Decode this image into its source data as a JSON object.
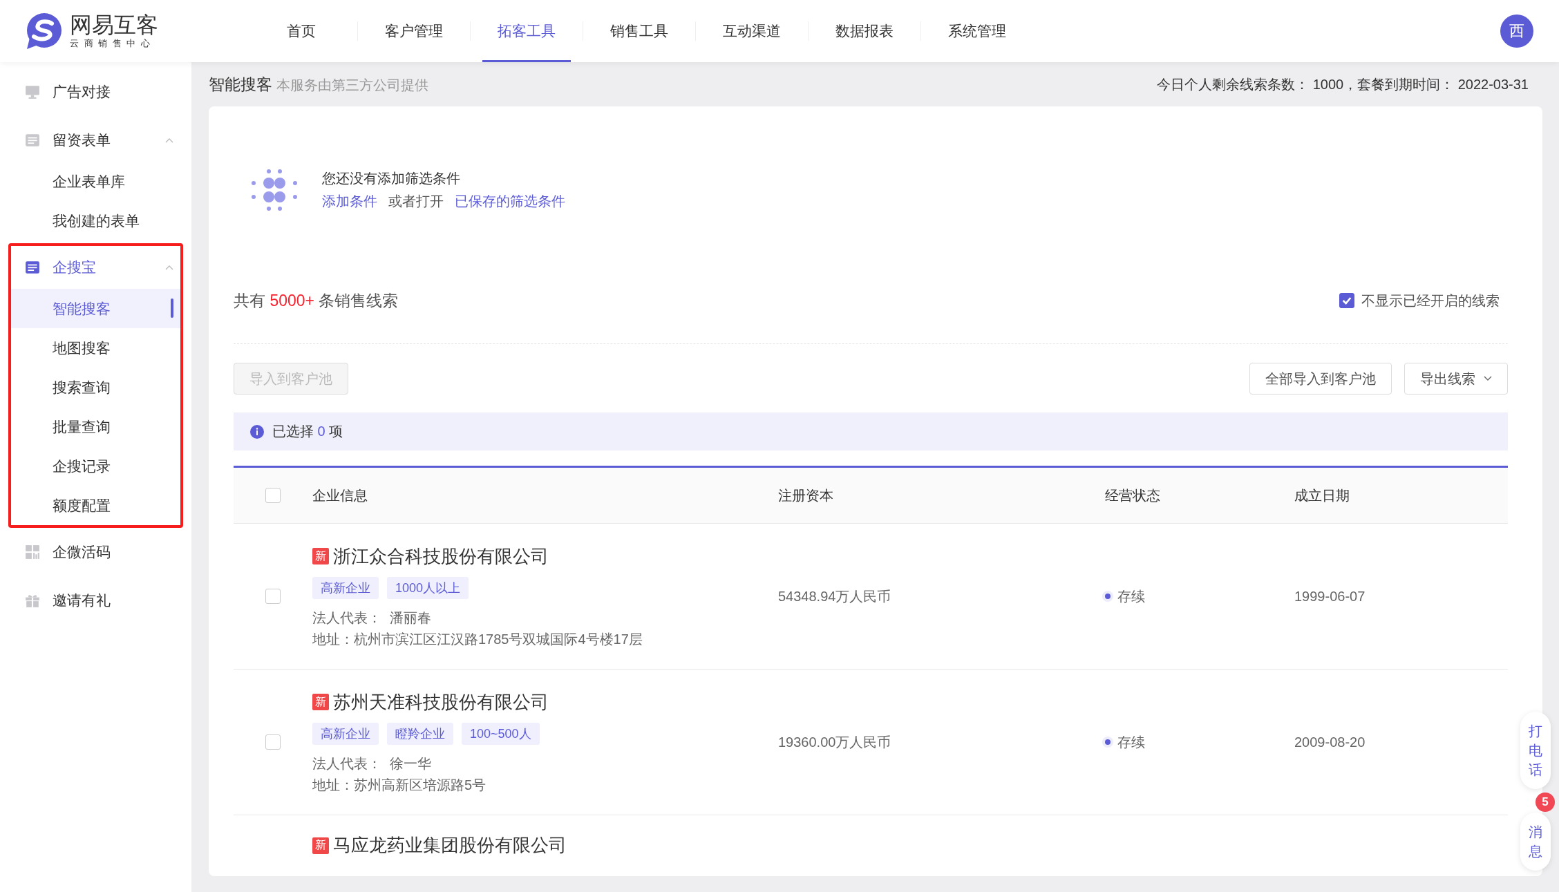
{
  "brand": {
    "name": "网易互客",
    "subtitle": "云 商 销 售 中 心"
  },
  "nav": [
    {
      "label": "首页",
      "selected": false
    },
    {
      "label": "客户管理",
      "selected": false
    },
    {
      "label": "拓客工具",
      "selected": true
    },
    {
      "label": "销售工具",
      "selected": false
    },
    {
      "label": "互动渠道",
      "selected": false
    },
    {
      "label": "数据报表",
      "selected": false
    },
    {
      "label": "系统管理",
      "selected": false
    }
  ],
  "avatar": "西",
  "sidebar": {
    "items": [
      {
        "label": "广告对接",
        "selected": false,
        "highlighted": false
      },
      {
        "label": "留资表单",
        "selected": false,
        "expanded": true,
        "highlighted": false,
        "children": [
          {
            "label": "企业表单库",
            "selected": false
          },
          {
            "label": "我创建的表单",
            "selected": false
          }
        ]
      },
      {
        "label": "企搜宝",
        "selected": true,
        "expanded": true,
        "highlighted": true,
        "children": [
          {
            "label": "智能搜客",
            "selected": true
          },
          {
            "label": "地图搜客",
            "selected": false
          },
          {
            "label": "搜索查询",
            "selected": false
          },
          {
            "label": "批量查询",
            "selected": false
          },
          {
            "label": "企搜记录",
            "selected": false
          },
          {
            "label": "额度配置",
            "selected": false
          }
        ]
      },
      {
        "label": "企微活码",
        "selected": false,
        "highlighted": false
      },
      {
        "label": "邀请有礼",
        "selected": false,
        "highlighted": false
      }
    ]
  },
  "page": {
    "title": "智能搜客",
    "subtitle": "本服务由第三方公司提供",
    "quota": "今日个人剩余线索条数： 1000，套餐到期时间： 2022-03-31"
  },
  "filter": {
    "empty_text": "您还没有添加筛选条件",
    "add_link": "添加条件",
    "or_text": "或者打开",
    "saved_link": "已保存的筛选条件"
  },
  "summary": {
    "prefix": "共有",
    "count": "5000+",
    "suffix": "条销售线索"
  },
  "hide_opened": {
    "label": "不显示已经开启的线索",
    "checked": true
  },
  "buttons": [
    {
      "label": "导入到客户池",
      "disabled": true
    },
    {
      "label": "全部导入到客户池",
      "disabled": false
    },
    {
      "label": "导出线索",
      "disabled": false
    }
  ],
  "selection": {
    "prefix": "已选择",
    "count": "0",
    "suffix": "项"
  },
  "table": {
    "select_all": {
      "checked": false
    },
    "columns": [
      "企业信息",
      "注册资本",
      "经营状态",
      "成立日期"
    ],
    "rows": [
      {
        "checked": false,
        "badge": "新",
        "name": "浙江众合科技股份有限公司",
        "tags": [
          "高新企业",
          "1000人以上"
        ],
        "legal_label": "法人代表：",
        "legal": "潘丽春",
        "address": "地址：杭州市滨江区江汉路1785号双城国际4号楼17层",
        "capital": "54348.94万人民币",
        "status": "存续",
        "date": "1999-06-07"
      },
      {
        "checked": false,
        "badge": "新",
        "name": "苏州天准科技股份有限公司",
        "tags": [
          "高新企业",
          "瞪羚企业",
          "100~500人"
        ],
        "legal_label": "法人代表：",
        "legal": "徐一华",
        "address": "地址：苏州高新区培源路5号",
        "capital": "19360.00万人民币",
        "status": "存续",
        "date": "2009-08-20"
      },
      {
        "badge": "新",
        "name": "马应龙药业集团股份有限公司"
      }
    ]
  },
  "float": [
    {
      "label": "打电话"
    },
    {
      "label": "消息",
      "count": "5"
    }
  ]
}
